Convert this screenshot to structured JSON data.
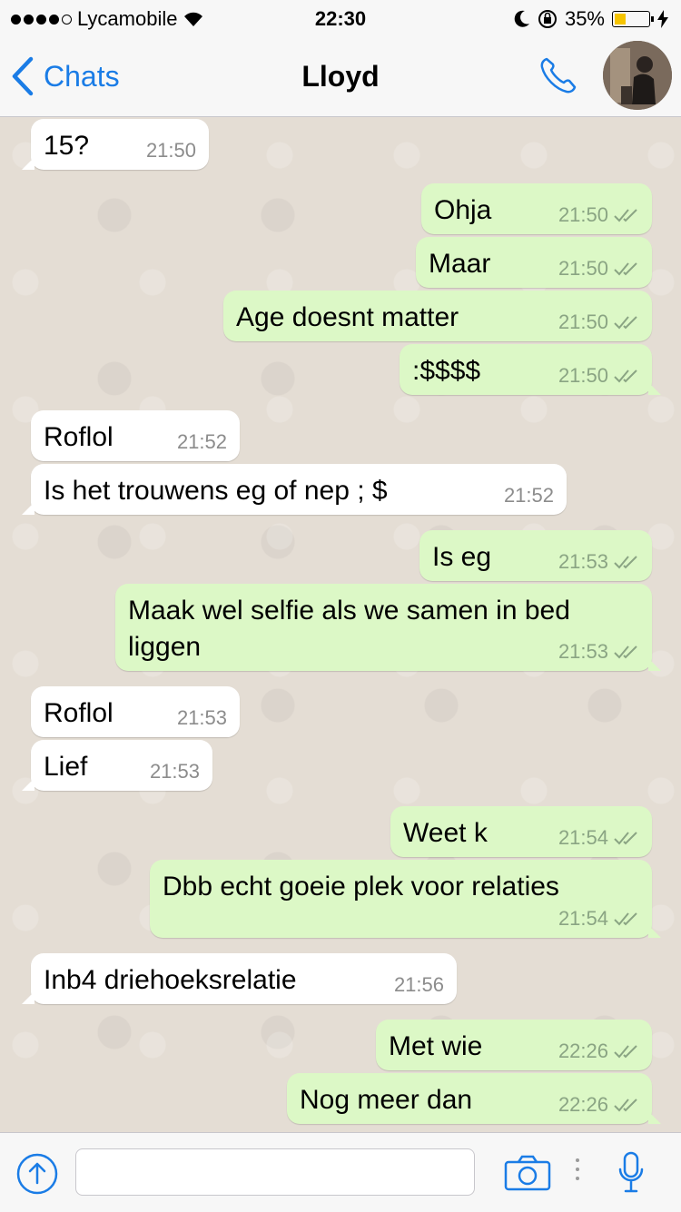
{
  "status_bar": {
    "carrier": "Lycamobile",
    "time": "22:30",
    "battery_percent": "35%",
    "battery_level": 0.35
  },
  "header": {
    "back_label": "Chats",
    "contact_name": "Lloyd"
  },
  "messages": [
    {
      "dir": "in",
      "text": "15?",
      "time": "21:50"
    },
    {
      "dir": "out",
      "text": "Ohja",
      "time": "21:50",
      "status": "read"
    },
    {
      "dir": "out",
      "text": "Maar",
      "time": "21:50",
      "status": "read"
    },
    {
      "dir": "out",
      "text": "Age doesnt matter",
      "time": "21:50",
      "status": "read"
    },
    {
      "dir": "out",
      "text": ":$$$$",
      "time": "21:50",
      "status": "read"
    },
    {
      "dir": "in",
      "text": "Roflol",
      "time": "21:52"
    },
    {
      "dir": "in",
      "text": "Is het trouwens eg of nep ; $",
      "time": "21:52"
    },
    {
      "dir": "out",
      "text": "Is eg",
      "time": "21:53",
      "status": "read"
    },
    {
      "dir": "out",
      "text": "Maak wel selfie als we samen in bed liggen",
      "time": "21:53",
      "status": "read"
    },
    {
      "dir": "in",
      "text": "Roflol",
      "time": "21:53"
    },
    {
      "dir": "in",
      "text": "Lief",
      "time": "21:53"
    },
    {
      "dir": "out",
      "text": "Weet k",
      "time": "21:54",
      "status": "read"
    },
    {
      "dir": "out",
      "text": "Dbb echt goeie plek voor relaties",
      "time": "21:54",
      "status": "read"
    },
    {
      "dir": "in",
      "text": "Inb4 driehoeksrelatie",
      "time": "21:56"
    },
    {
      "dir": "out",
      "text": "Met wie",
      "time": "22:26",
      "status": "read"
    },
    {
      "dir": "out",
      "text": "Nog meer dan",
      "time": "22:26",
      "status": "read"
    }
  ],
  "input": {
    "value": "",
    "placeholder": ""
  },
  "icons": {
    "back": "chevron-left-icon",
    "call": "phone-icon",
    "share": "share-upload-icon",
    "camera": "camera-icon",
    "mic": "microphone-icon",
    "read_receipt": "double-check-icon"
  },
  "colors": {
    "accent": "#1a7ce6",
    "outgoing_bubble": "#dcf8c6",
    "incoming_bubble": "#ffffff",
    "battery_fill": "#f5c400"
  }
}
